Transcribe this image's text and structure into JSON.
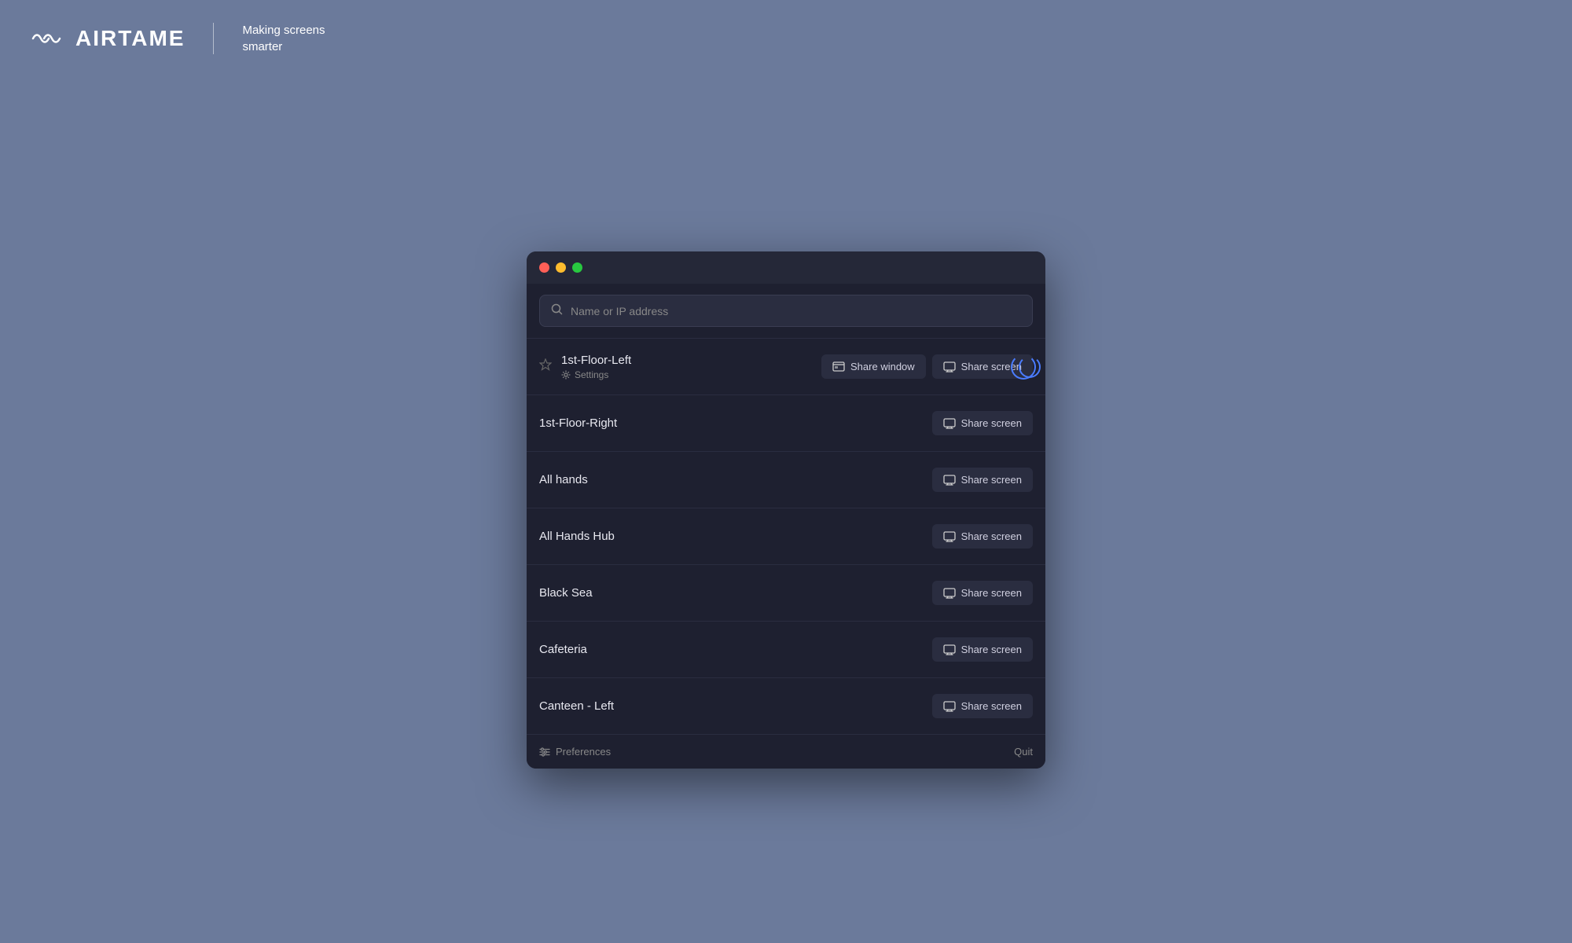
{
  "logo": {
    "text": "AIRTAME",
    "tagline": "Making screens\nsmarter"
  },
  "window": {
    "traffic_lights": [
      "close",
      "minimize",
      "maximize"
    ]
  },
  "search": {
    "placeholder": "Name or IP address"
  },
  "devices": [
    {
      "id": "1st-floor-left",
      "name": "1st-Floor-Left",
      "has_settings": true,
      "settings_label": "Settings",
      "show_share_window": true,
      "share_window_label": "Share window",
      "share_screen_label": "Share screen",
      "active": true
    },
    {
      "id": "1st-floor-right",
      "name": "1st-Floor-Right",
      "has_settings": false,
      "show_share_window": false,
      "share_screen_label": "Share screen",
      "active": false
    },
    {
      "id": "all-hands",
      "name": "All hands",
      "has_settings": false,
      "show_share_window": false,
      "share_screen_label": "Share screen",
      "active": false
    },
    {
      "id": "all-hands-hub",
      "name": "All Hands Hub",
      "has_settings": false,
      "show_share_window": false,
      "share_screen_label": "Share screen",
      "active": false
    },
    {
      "id": "black-sea",
      "name": "Black Sea",
      "has_settings": false,
      "show_share_window": false,
      "share_screen_label": "Share screen",
      "active": false
    },
    {
      "id": "cafeteria",
      "name": "Cafeteria",
      "has_settings": false,
      "show_share_window": false,
      "share_screen_label": "Share screen",
      "active": false
    },
    {
      "id": "canteen-left",
      "name": "Canteen - Left",
      "has_settings": false,
      "show_share_window": false,
      "share_screen_label": "Share screen",
      "active": false
    }
  ],
  "footer": {
    "preferences_label": "Preferences",
    "quit_label": "Quit"
  },
  "colors": {
    "background": "#6b7a9b",
    "window_bg": "#1e2030",
    "row_border": "#2a2d40",
    "button_bg": "#2a2d40",
    "active_ring": "#4a7cff"
  }
}
